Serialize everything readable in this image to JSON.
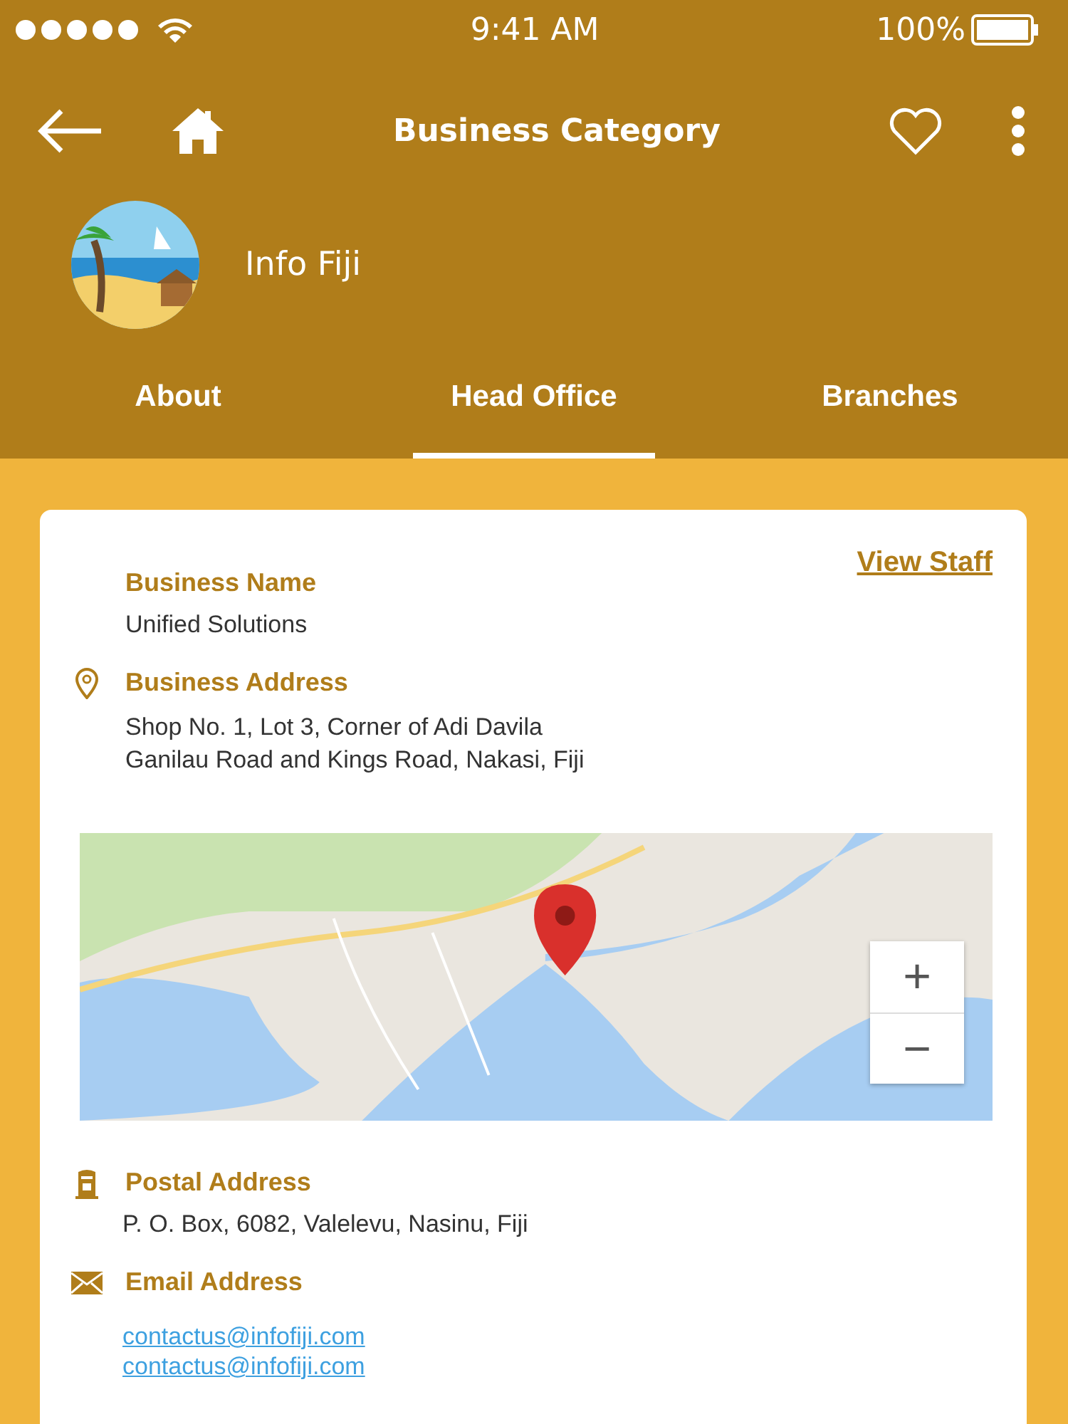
{
  "status_bar": {
    "time": "9:41 AM",
    "battery": "100%"
  },
  "header": {
    "title": "Business Category",
    "business_name": "Info Fiji"
  },
  "tabs": [
    {
      "label": "About",
      "selected": false
    },
    {
      "label": "Head Office",
      "selected": true
    },
    {
      "label": "Branches",
      "selected": false
    }
  ],
  "card": {
    "view_staff": "View Staff",
    "sections": [
      {
        "kind": "name",
        "label": "Business Name",
        "lines": [
          "Unified Solutions"
        ]
      },
      {
        "kind": "address",
        "label": "Business Address",
        "lines": [
          "Shop No. 1, Lot 3, Corner of Adi Davila",
          "Ganilau Road and Kings Road, Nakasi, Fiji"
        ]
      },
      {
        "kind": "map",
        "zoom_in": "+",
        "zoom_out": "−"
      },
      {
        "kind": "postal",
        "label": "Postal Address",
        "lines": [
          "P. O. Box, 6082, Valelevu, Nasinu, Fiji"
        ]
      },
      {
        "kind": "email",
        "label": "Email Address",
        "lines": [
          "contactus@infofiji.com",
          "contactus@infofiji.com"
        ]
      }
    ]
  }
}
